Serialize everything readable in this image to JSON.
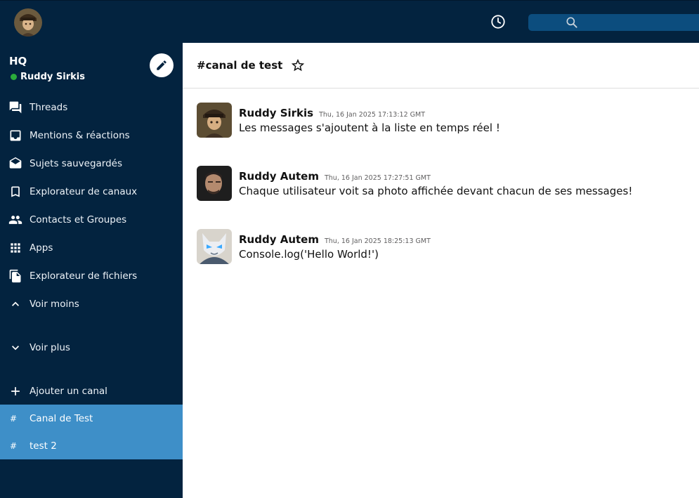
{
  "header": {
    "history_icon": "clock-icon",
    "search_icon": "search-icon",
    "search_placeholder": ""
  },
  "sidebar": {
    "workspace": "HQ",
    "user_name": "Ruddy Sirkis",
    "status_color": "#2bac3b",
    "nav": [
      {
        "label": "Threads",
        "icon": "threads-icon"
      },
      {
        "label": "Mentions & réactions",
        "icon": "inbox-icon"
      },
      {
        "label": "Sujets sauvegardés",
        "icon": "drafts-icon"
      },
      {
        "label": "Explorateur de canaux",
        "icon": "bookmark-icon"
      },
      {
        "label": "Contacts et Groupes",
        "icon": "people-icon"
      },
      {
        "label": "Apps",
        "icon": "apps-grid-icon"
      },
      {
        "label": "Explorateur de fichiers",
        "icon": "files-icon"
      },
      {
        "label": "Voir moins",
        "icon": "chevron-up-icon"
      }
    ],
    "see_more": "Voir plus",
    "add_channel": "Ajouter un canal",
    "channels": [
      {
        "prefix": "#",
        "name": "Canal de Test"
      },
      {
        "prefix": "#",
        "name": "test 2"
      }
    ],
    "channel_highlight_color": "#3e8fc8",
    "background_color": "#03233f"
  },
  "channel": {
    "title": "#canal de test",
    "star_icon": "star-outline-icon"
  },
  "messages": [
    {
      "author": "Ruddy Sirkis",
      "time": "Thu, 16 Jan 2025 17:13:12 GMT",
      "text": "Les messages s'ajoutent à la liste en temps réel !"
    },
    {
      "author": "Ruddy Autem",
      "time": "Thu, 16 Jan 2025 17:27:51 GMT",
      "text": "Chaque utilisateur voit sa photo affichée devant chacun de ses messages!"
    },
    {
      "author": "Ruddy Autem",
      "time": "Thu, 16 Jan 2025 18:25:13 GMT",
      "text": "Console.log('Hello World!')"
    }
  ]
}
